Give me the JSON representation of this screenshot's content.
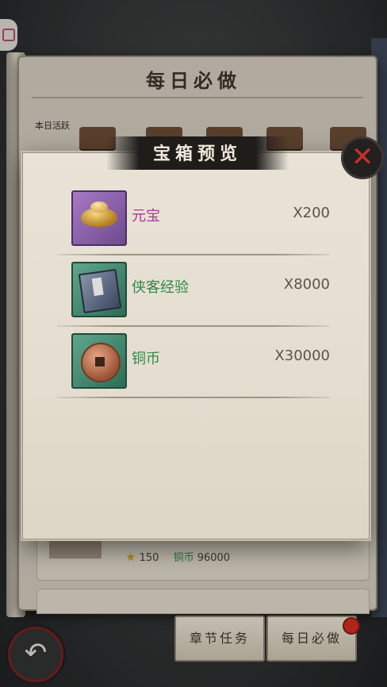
{
  "book": {
    "title": "每日必做",
    "activity_label": "本日活跃",
    "task_reward": {
      "stars": "150",
      "currency_label": "铜币",
      "currency_value": "96000"
    },
    "bottom_tabs": [
      {
        "label": "章节任务"
      },
      {
        "label": "每日必做"
      }
    ]
  },
  "modal": {
    "title": "宝箱预览",
    "close_icon": "close-icon",
    "rewards": [
      {
        "name": "元宝",
        "quantity": "X200",
        "rarity_color": "#a33a95",
        "icon": "gold-ingot-icon"
      },
      {
        "name": "侠客经验",
        "quantity": "X8000",
        "rarity_color": "#2e8a4a",
        "icon": "exp-book-icon"
      },
      {
        "name": "铜币",
        "quantity": "X30000",
        "rarity_color": "#2e8a4a",
        "icon": "copper-coin-icon"
      }
    ]
  },
  "colors": {
    "accent_red": "#d02b1f",
    "purple_quality": "#a33a95",
    "green_quality": "#2e8a4a"
  }
}
